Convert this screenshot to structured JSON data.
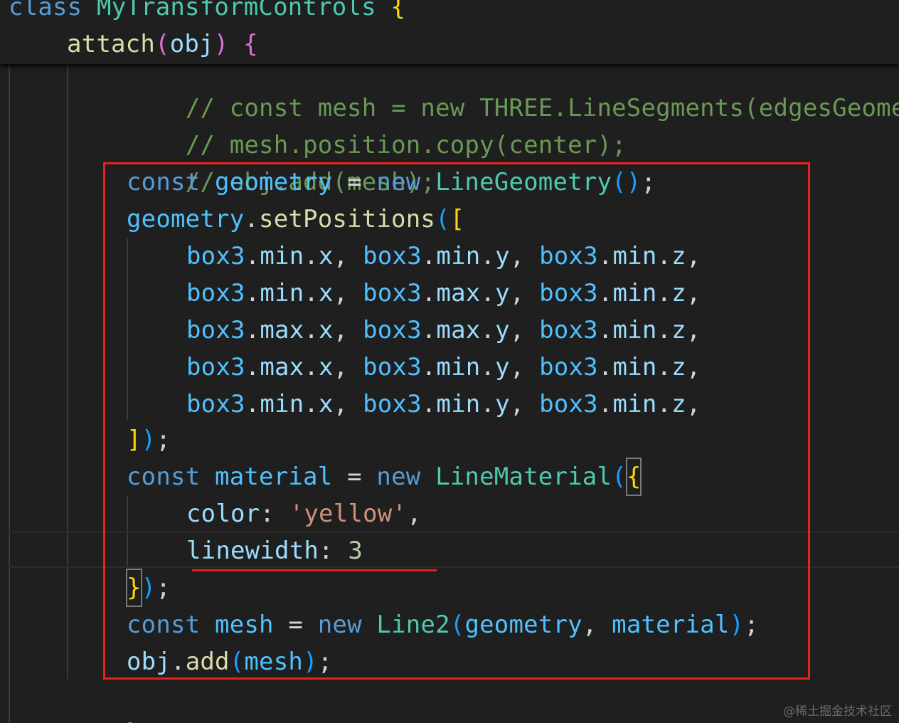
{
  "colors": {
    "background": "#1f1f1f",
    "keyword": "#569cd6",
    "variable": "#9cdcfe",
    "constant": "#4fc1ff",
    "class": "#4ec9b0",
    "function": "#dcdcaa",
    "string": "#ce9178",
    "number": "#b5cea8",
    "comment": "#6a9955",
    "punctuation": "#d4d4d4",
    "bracket_gold": "#ffd700",
    "bracket_purple": "#da70d6",
    "bracket_blue": "#179fff",
    "annotation_red": "#e8231f"
  },
  "sticky_header": {
    "class_line": {
      "kw": "class",
      "name": "MyTransformControls",
      "brace": "{"
    },
    "method_line": {
      "name": "attach",
      "open": "(",
      "param": "obj",
      "close": ")",
      "brace": "{"
    }
  },
  "code": {
    "comment1": "// const mesh = new THREE.LineSegments(edgesGeometry",
    "comment2": "// mesh.position.copy(center);",
    "comment3": "// obj.add(mesh);",
    "geo_decl": {
      "kw": "const",
      "var": "geometry",
      "eq": "=",
      "new": "new",
      "cls": "LineGeometry",
      "parens": "()",
      "semi": ";"
    },
    "set_pos": {
      "obj": "geometry",
      "dot": ".",
      "fn": "setPositions",
      "open_paren": "(",
      "open_bracket": "["
    },
    "positions": [
      [
        "min",
        "x",
        "min",
        "y",
        "min",
        "z"
      ],
      [
        "min",
        "x",
        "max",
        "y",
        "min",
        "z"
      ],
      [
        "max",
        "x",
        "max",
        "y",
        "min",
        "z"
      ],
      [
        "max",
        "x",
        "min",
        "y",
        "min",
        "z"
      ],
      [
        "min",
        "x",
        "min",
        "y",
        "min",
        "z"
      ]
    ],
    "box_name": "box3",
    "close_setpos": {
      "bracket": "]",
      "paren": ")",
      "semi": ";"
    },
    "mat_decl": {
      "kw": "const",
      "var": "material",
      "eq": "=",
      "new": "new",
      "cls": "LineMaterial",
      "open_paren": "(",
      "open_brace": "{"
    },
    "color_prop": {
      "key": "color",
      "colon": ":",
      "value": "'yellow'",
      "comma": ","
    },
    "linewidth_prop": {
      "key": "linewidth",
      "colon": ":",
      "value": "3"
    },
    "close_mat": {
      "brace": "}",
      "paren": ")",
      "semi": ";"
    },
    "mesh_decl": {
      "kw": "const",
      "var": "mesh",
      "eq": "=",
      "new": "new",
      "cls": "Line2",
      "open": "(",
      "arg1": "geometry",
      "comma": ",",
      "arg2": "material",
      "close": ")",
      "semi": ";"
    },
    "add_line": {
      "obj": "obj",
      "dot": ".",
      "fn": "add",
      "open": "(",
      "arg": "mesh",
      "close": ")",
      "semi": ";"
    },
    "closing_brace": "}"
  },
  "watermark": "@稀土掘金技术社区"
}
